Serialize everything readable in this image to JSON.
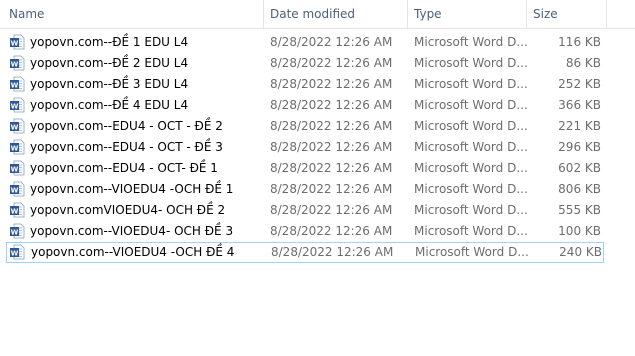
{
  "columns": {
    "name": "Name",
    "date": "Date modified",
    "type": "Type",
    "size": "Size"
  },
  "sort": {
    "column": "name",
    "icon": "chevron-up-icon"
  },
  "files": [
    {
      "name": "yopovn.com--ĐỀ 1 EDU L4",
      "date": "8/28/2022 12:26 AM",
      "type": "Microsoft Word D...",
      "size": "116 KB",
      "icon": "word-document-icon"
    },
    {
      "name": "yopovn.com--ĐỀ 2 EDU L4",
      "date": "8/28/2022 12:26 AM",
      "type": "Microsoft Word D...",
      "size": "86 KB",
      "icon": "word-document-icon"
    },
    {
      "name": "yopovn.com--ĐỀ 3 EDU L4",
      "date": "8/28/2022 12:26 AM",
      "type": "Microsoft Word D...",
      "size": "252 KB",
      "icon": "word-document-icon"
    },
    {
      "name": "yopovn.com--ĐỀ 4 EDU L4",
      "date": "8/28/2022 12:26 AM",
      "type": "Microsoft Word D...",
      "size": "366 KB",
      "icon": "word-document-icon"
    },
    {
      "name": "yopovn.com--EDU4 -  OCT - ĐỀ 2",
      "date": "8/28/2022 12:26 AM",
      "type": "Microsoft Word D...",
      "size": "221 KB",
      "icon": "word-document-icon"
    },
    {
      "name": "yopovn.com--EDU4 -  OCT - ĐỀ 3",
      "date": "8/28/2022 12:26 AM",
      "type": "Microsoft Word D...",
      "size": "296 KB",
      "icon": "word-document-icon"
    },
    {
      "name": "yopovn.com--EDU4 - OCT- ĐỀ 1",
      "date": "8/28/2022 12:26 AM",
      "type": "Microsoft Word D...",
      "size": "602 KB",
      "icon": "word-document-icon"
    },
    {
      "name": "yopovn.com--VIOEDU4 -OCH ĐỀ 1",
      "date": "8/28/2022 12:26 AM",
      "type": "Microsoft Word D...",
      "size": "806 KB",
      "icon": "word-document-icon"
    },
    {
      "name": "yopovn.comVIOEDU4- OCH ĐỀ 2",
      "date": "8/28/2022 12:26 AM",
      "type": "Microsoft Word D...",
      "size": "555 KB",
      "icon": "word-document-icon"
    },
    {
      "name": "yopovn.com--VIOEDU4- OCH ĐỀ 3",
      "date": "8/28/2022 12:26 AM",
      "type": "Microsoft Word D...",
      "size": "100 KB",
      "icon": "word-document-icon"
    },
    {
      "name": "yopovn.com--VIOEDU4 -OCH ĐỀ 4",
      "date": "8/28/2022 12:26 AM",
      "type": "Microsoft Word D...",
      "size": "240 KB",
      "icon": "word-document-icon",
      "selected": true
    }
  ],
  "colors": {
    "header_text": "#4c607a",
    "secondary_text": "#6d6d6d",
    "selection_border": "#99d1ff",
    "word_blue": "#2b579a"
  }
}
